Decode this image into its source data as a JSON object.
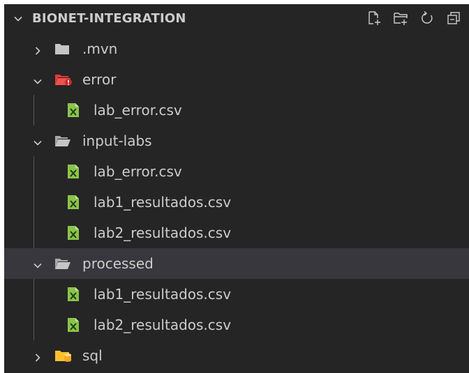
{
  "explorer": {
    "title": "BIONET-INTEGRATION",
    "actions": [
      {
        "name": "new-file-icon"
      },
      {
        "name": "new-folder-icon"
      },
      {
        "name": "refresh-icon"
      },
      {
        "name": "collapse-all-icon"
      }
    ],
    "tree": [
      {
        "label": ".mvn",
        "type": "folder",
        "expanded": false,
        "icon": "folder-icon"
      },
      {
        "label": "error",
        "type": "folder",
        "expanded": true,
        "icon": "error-folder-icon"
      },
      {
        "label": "lab_error.csv",
        "type": "file",
        "icon": "csv-file-icon"
      },
      {
        "label": "input-labs",
        "type": "folder",
        "expanded": true,
        "icon": "folder-open-icon"
      },
      {
        "label": "lab_error.csv",
        "type": "file",
        "icon": "csv-file-icon"
      },
      {
        "label": "lab1_resultados.csv",
        "type": "file",
        "icon": "csv-file-icon"
      },
      {
        "label": "lab2_resultados.csv",
        "type": "file",
        "icon": "csv-file-icon"
      },
      {
        "label": "processed",
        "type": "folder",
        "expanded": true,
        "selected": true,
        "icon": "folder-open-icon"
      },
      {
        "label": "lab1_resultados.csv",
        "type": "file",
        "icon": "csv-file-icon"
      },
      {
        "label": "lab2_resultados.csv",
        "type": "file",
        "icon": "csv-file-icon"
      },
      {
        "label": "sql",
        "type": "folder",
        "expanded": false,
        "icon": "sql-folder-icon"
      }
    ],
    "colors": {
      "background": "#252526",
      "selected_row": "#37373d",
      "text": "#cccccc",
      "csv_icon": "#8bc34a",
      "error_folder": "#e53935",
      "sql_folder": "#fbc02d",
      "folder": "#c5c5c5"
    }
  }
}
